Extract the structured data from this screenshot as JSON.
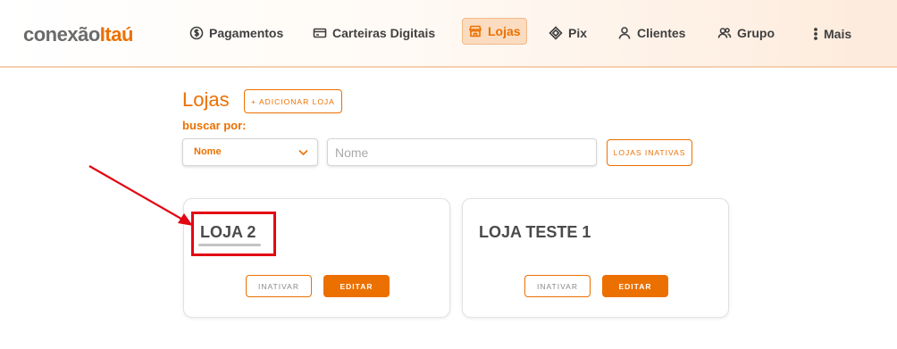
{
  "header": {
    "logo": {
      "part1": "conexão",
      "part2": "Itaú"
    },
    "nav": [
      {
        "label": "Pagamentos",
        "icon": "dollar-circle-icon"
      },
      {
        "label": "Carteiras Digitais",
        "icon": "wallet-card-icon"
      },
      {
        "label": "Lojas",
        "icon": "store-icon",
        "active": true
      },
      {
        "label": "Pix",
        "icon": "pix-icon"
      },
      {
        "label": "Clientes",
        "icon": "user-icon"
      },
      {
        "label": "Grupo",
        "icon": "users-icon"
      },
      {
        "label": "Mais",
        "icon": "more-vertical-icon"
      }
    ]
  },
  "main": {
    "title": "Lojas",
    "add_button": "+ ADICIONAR LOJA",
    "search_label": "buscar por:",
    "search_select_value": "Nome",
    "search_input_placeholder": "Nome",
    "inactive_button": "LOJAS INATIVAS",
    "cards": [
      {
        "name": "LOJA 2",
        "inativar": "INATIVAR",
        "editar": "EDITAR"
      },
      {
        "name": "LOJA TESTE 1",
        "inativar": "INATIVAR",
        "editar": "EDITAR"
      }
    ]
  },
  "colors": {
    "accent": "#ec7000",
    "annotation": "#e30613",
    "text": "#4a4a4a"
  }
}
